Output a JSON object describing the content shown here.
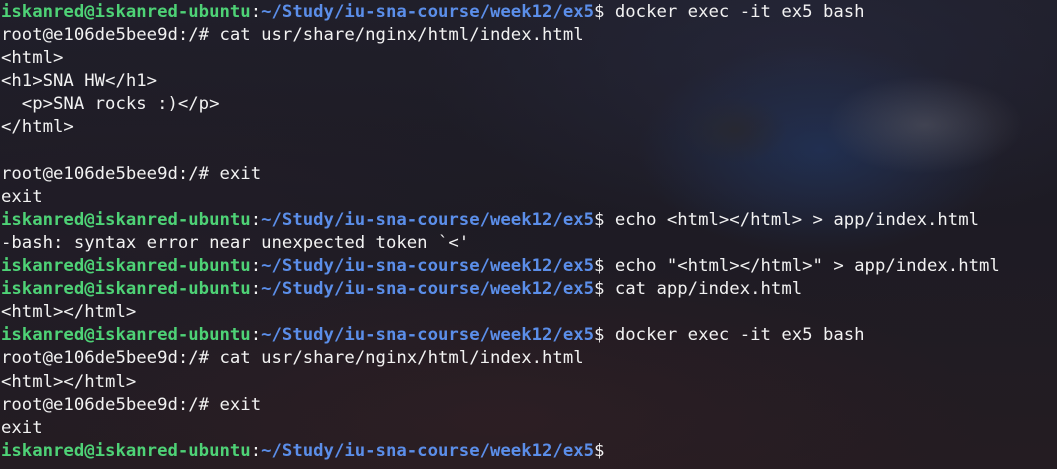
{
  "terminal": {
    "user_host": "iskanred@iskanred-ubuntu",
    "host_sep": ":",
    "cwd": "~/Study/iu-sna-course/week12/ex5",
    "prompt_end": "$",
    "lines": [
      {
        "kind": "prompt",
        "command": " docker exec -it ex5 bash"
      },
      {
        "kind": "output",
        "text": "root@e106de5bee9d:/# cat usr/share/nginx/html/index.html"
      },
      {
        "kind": "output",
        "text": "<html>"
      },
      {
        "kind": "output",
        "text": "<h1>SNA HW</h1>"
      },
      {
        "kind": "output",
        "text": "  <p>SNA rocks :)</p>"
      },
      {
        "kind": "output",
        "text": "</html>"
      },
      {
        "kind": "output",
        "text": ""
      },
      {
        "kind": "output",
        "text": "root@e106de5bee9d:/# exit"
      },
      {
        "kind": "output",
        "text": "exit"
      },
      {
        "kind": "prompt",
        "command": " echo <html></html> > app/index.html"
      },
      {
        "kind": "output",
        "text": "-bash: syntax error near unexpected token `<'"
      },
      {
        "kind": "prompt",
        "command": " echo \"<html></html>\" > app/index.html"
      },
      {
        "kind": "prompt",
        "command": " cat app/index.html"
      },
      {
        "kind": "output",
        "text": "<html></html>"
      },
      {
        "kind": "prompt",
        "command": " docker exec -it ex5 bash"
      },
      {
        "kind": "output",
        "text": "root@e106de5bee9d:/# cat usr/share/nginx/html/index.html"
      },
      {
        "kind": "output",
        "text": "<html></html>"
      },
      {
        "kind": "output",
        "text": "root@e106de5bee9d:/# exit"
      },
      {
        "kind": "output",
        "text": "exit"
      },
      {
        "kind": "prompt",
        "command": ""
      }
    ]
  },
  "colors": {
    "user_host": "#4ed276",
    "path": "#5b8ee9",
    "text": "#f2f2f2"
  }
}
